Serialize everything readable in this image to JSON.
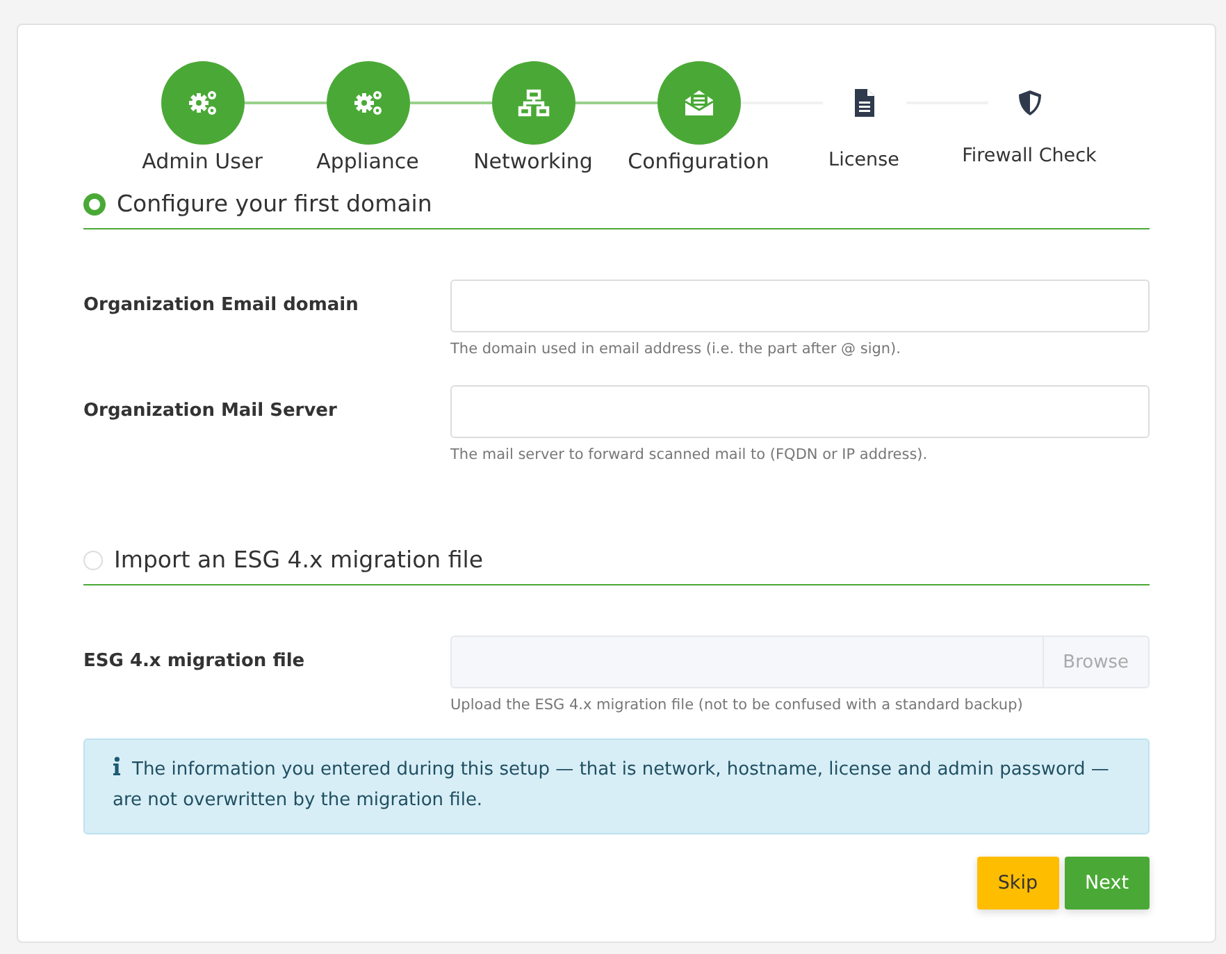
{
  "steps": [
    {
      "label": "Admin User",
      "kind": "gears",
      "done": true
    },
    {
      "label": "Appliance",
      "kind": "gears",
      "done": true
    },
    {
      "label": "Networking",
      "kind": "network",
      "done": true
    },
    {
      "label": "Configuration",
      "kind": "envelope",
      "done": true
    },
    {
      "label": "License",
      "kind": "file",
      "done": false
    },
    {
      "label": "Firewall Check",
      "kind": "shield",
      "done": false
    }
  ],
  "sections": [
    {
      "title": "Configure your first domain",
      "selected": true,
      "fields": [
        {
          "kind": "text",
          "label": "Organization Email domain",
          "help": "The domain used in email address (i.e. the part after @ sign)."
        },
        {
          "kind": "text",
          "label": "Organization Mail Server",
          "help": "The mail server to forward scanned mail to (FQDN or IP address)."
        }
      ]
    },
    {
      "title": "Import an ESG 4.x migration file",
      "selected": false,
      "fields": [
        {
          "kind": "file",
          "label": "ESG 4.x migration file",
          "button": "Browse",
          "disabled": true,
          "help": "Upload the ESG 4.x migration file (not to be confused with a standard backup)"
        }
      ]
    }
  ],
  "info": "The information you entered during this setup — that is network, hostname, license and admin password — are not overwritten by the migration file.",
  "buttons": [
    {
      "label": "Skip",
      "kind": "warning"
    },
    {
      "label": "Next",
      "kind": "primary"
    }
  ]
}
